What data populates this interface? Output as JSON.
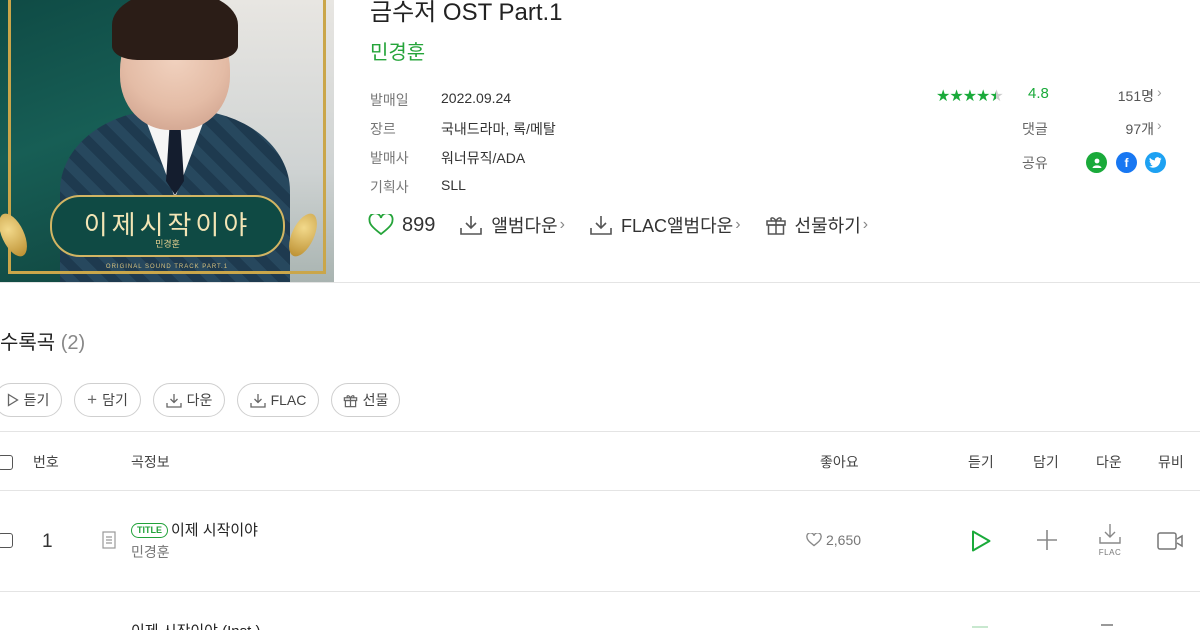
{
  "album": {
    "title": "금수저 OST Part.1",
    "artist": "민경훈",
    "cover": {
      "plate_title": "이제시작이야",
      "plate_artist": "민경훈",
      "ost_line": "ORIGINAL SOUND TRACK PART.1"
    },
    "meta": [
      {
        "label": "발매일",
        "value": "2022.09.24"
      },
      {
        "label": "장르",
        "value": "국내드라마, 록/메탈"
      },
      {
        "label": "발매사",
        "value": "워너뮤직/ADA"
      },
      {
        "label": "기획사",
        "value": "SLL"
      }
    ],
    "rating": {
      "score": "4.8",
      "stars": 4.5,
      "raters": "151명"
    },
    "comments": {
      "label": "댓글",
      "count": "97개"
    },
    "share": {
      "label": "공유",
      "icons": [
        "melon-profile-icon",
        "facebook-icon",
        "twitter-icon"
      ]
    },
    "likes": "899",
    "actions": {
      "download": "앨범다운",
      "flac": "FLAC앨범다운",
      "gift": "선물하기"
    }
  },
  "tracklist": {
    "title": "수록곡",
    "count": "(2)",
    "buttons": {
      "listen": "듣기",
      "add": "담기",
      "download": "다운",
      "flac": "FLAC",
      "gift": "선물"
    },
    "columns": {
      "number": "번호",
      "info": "곡정보",
      "likes": "좋아요",
      "listen": "듣기",
      "add": "담기",
      "download": "다운",
      "mv": "뮤비"
    },
    "rows": [
      {
        "number": "1",
        "badge": "TITLE",
        "song": "이제 시작이야",
        "artist": "민경훈",
        "likes": "2,650",
        "flac": "FLAC"
      },
      {
        "number": "",
        "badge": "",
        "song": "이제 시작이야 (Inst.)",
        "artist": "",
        "likes": "",
        "flac": ""
      }
    ]
  },
  "colors": {
    "accent": "#25a43a",
    "facebook": "#1877f2",
    "twitter": "#1da1f2",
    "profile": "#1aaa3a"
  }
}
